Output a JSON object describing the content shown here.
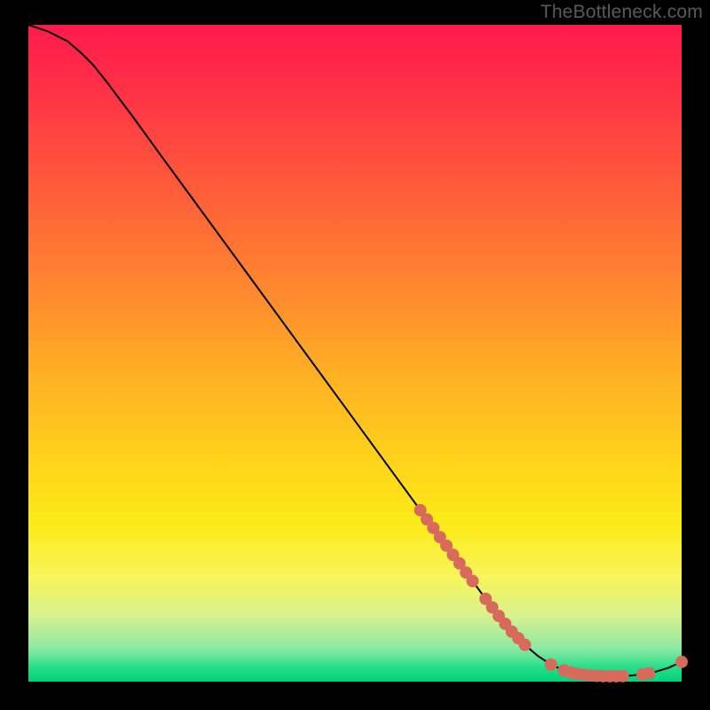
{
  "watermark": "TheBottleneck.com",
  "colors": {
    "background": "#000000",
    "curve": "#000000",
    "dot": "#d86a5c",
    "gradient_top": "#ff1a4d",
    "gradient_bottom": "#00d27a"
  },
  "chart_data": {
    "type": "line",
    "title": "",
    "xlabel": "",
    "ylabel": "",
    "xlim": [
      0,
      100
    ],
    "ylim": [
      0,
      100
    ],
    "grid": false,
    "legend": false,
    "series": [
      {
        "name": "curve",
        "x": [
          0,
          3,
          6,
          8,
          10,
          12,
          16,
          20,
          25,
          30,
          35,
          40,
          45,
          50,
          55,
          60,
          62,
          64,
          66,
          68,
          70,
          72,
          74,
          76,
          78,
          80,
          82,
          84,
          86,
          88,
          90,
          92,
          94,
          96,
          98,
          100
        ],
        "y": [
          100,
          99,
          97.5,
          95.8,
          93.8,
          91.3,
          86,
          80.5,
          73.7,
          66.9,
          60.1,
          53.3,
          46.5,
          39.7,
          32.9,
          26.1,
          23.4,
          20.7,
          18,
          15.3,
          12.6,
          10,
          7.6,
          5.6,
          3.9,
          2.6,
          1.7,
          1.2,
          0.9,
          0.8,
          0.8,
          0.9,
          1.1,
          1.5,
          2.1,
          3
        ]
      }
    ],
    "markers": [
      {
        "x": 60,
        "y": 26.1
      },
      {
        "x": 61,
        "y": 24.7
      },
      {
        "x": 62,
        "y": 23.4
      },
      {
        "x": 63,
        "y": 22.0
      },
      {
        "x": 64,
        "y": 20.7
      },
      {
        "x": 65,
        "y": 19.3
      },
      {
        "x": 66,
        "y": 18.0
      },
      {
        "x": 67,
        "y": 16.6
      },
      {
        "x": 68,
        "y": 15.3
      },
      {
        "x": 70,
        "y": 12.6
      },
      {
        "x": 71,
        "y": 11.3
      },
      {
        "x": 72,
        "y": 10.0
      },
      {
        "x": 73,
        "y": 8.8
      },
      {
        "x": 74,
        "y": 7.6
      },
      {
        "x": 75,
        "y": 6.6
      },
      {
        "x": 76,
        "y": 5.6
      },
      {
        "x": 80,
        "y": 2.6
      },
      {
        "x": 82,
        "y": 1.7
      },
      {
        "x": 83,
        "y": 1.4
      },
      {
        "x": 84,
        "y": 1.2
      },
      {
        "x": 85,
        "y": 1.05
      },
      {
        "x": 86,
        "y": 0.95
      },
      {
        "x": 87,
        "y": 0.88
      },
      {
        "x": 88,
        "y": 0.83
      },
      {
        "x": 89,
        "y": 0.82
      },
      {
        "x": 90,
        "y": 0.82
      },
      {
        "x": 91,
        "y": 0.84
      },
      {
        "x": 94,
        "y": 1.1
      },
      {
        "x": 95,
        "y": 1.28
      },
      {
        "x": 100,
        "y": 3.0
      }
    ]
  }
}
